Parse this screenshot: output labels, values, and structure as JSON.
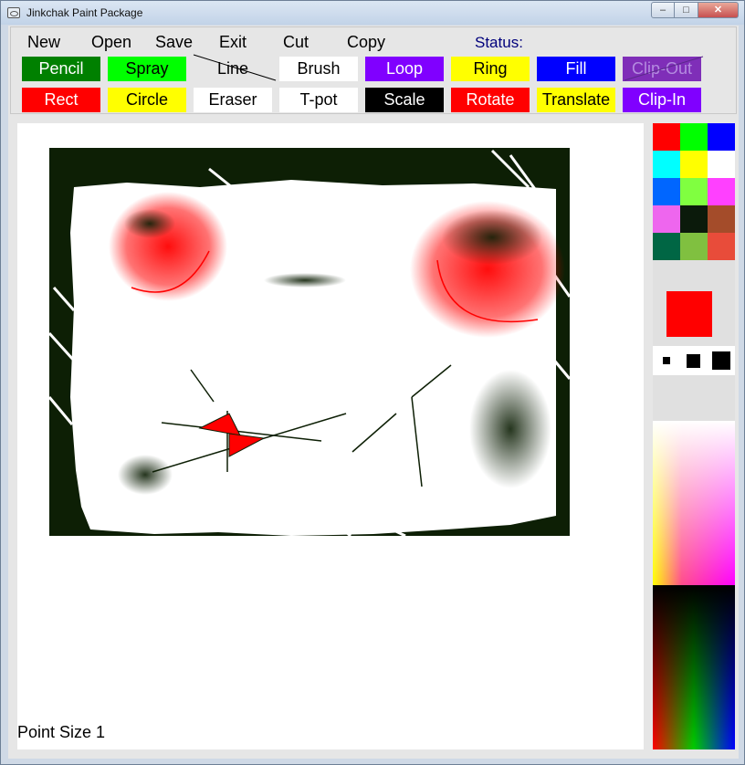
{
  "window": {
    "title": "Jinkchak Paint Package",
    "min_glyph": "–",
    "max_glyph": "□",
    "close_glyph": "✕"
  },
  "menu": {
    "new": "New",
    "open": "Open",
    "save": "Save",
    "exit": "Exit",
    "cut": "Cut",
    "copy": "Copy",
    "status_label": "Status:"
  },
  "tools": [
    {
      "label": "Pencil",
      "bg": "#008000",
      "fg": "#ffffff"
    },
    {
      "label": "Spray",
      "bg": "#00ff00",
      "fg": "#000000"
    },
    {
      "label": "Line",
      "bg": "#e6e6e6",
      "fg": "#000000"
    },
    {
      "label": "Brush",
      "bg": "#ffffff",
      "fg": "#000000"
    },
    {
      "label": "Loop",
      "bg": "#8000ff",
      "fg": "#ffffff"
    },
    {
      "label": "Ring",
      "bg": "#ffff00",
      "fg": "#000000"
    },
    {
      "label": "Fill",
      "bg": "#0000ff",
      "fg": "#ffffff"
    },
    {
      "label": "Clip-Out",
      "bg": "#7f2eb8",
      "fg": "#b48be0"
    },
    {
      "label": "Rect",
      "bg": "#ff0000",
      "fg": "#ffffff"
    },
    {
      "label": "Circle",
      "bg": "#ffff00",
      "fg": "#000000"
    },
    {
      "label": "Eraser",
      "bg": "#ffffff",
      "fg": "#000000"
    },
    {
      "label": "T-pot",
      "bg": "#ffffff",
      "fg": "#000000"
    },
    {
      "label": "Scale",
      "bg": "#000000",
      "fg": "#ffffff"
    },
    {
      "label": "Rotate",
      "bg": "#ff0000",
      "fg": "#ffffff"
    },
    {
      "label": "Translate",
      "bg": "#ffff00",
      "fg": "#000000"
    },
    {
      "label": "Clip-In",
      "bg": "#8000ff",
      "fg": "#ffffff"
    }
  ],
  "palette": {
    "swatches": [
      "#ff0000",
      "#00ff00",
      "#0000ff",
      "#00ffff",
      "#ffff00",
      "#ffffff",
      "#0066ff",
      "#80ff40",
      "#ff40ff",
      "#ee66ee",
      "#0b1a0b",
      "#a44c2a",
      "#006644",
      "#80c040",
      "#e84c3a"
    ],
    "current_color": "#ff0000"
  },
  "canvas": {
    "point_size_text": "Point Size 1",
    "background_fill": "#0d1f05",
    "accent_red": "#ff0000"
  }
}
